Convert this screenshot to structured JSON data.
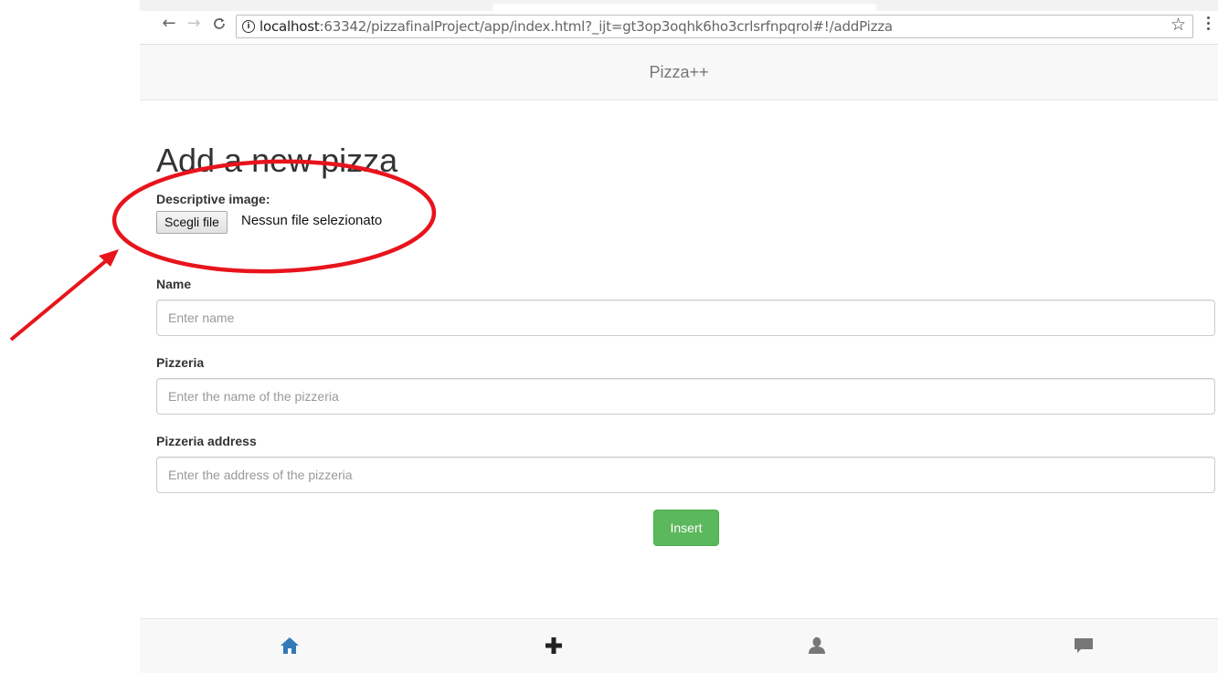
{
  "browser": {
    "url_host": "localhost",
    "url_rest": ":63342/pizzafinalProject/app/index.html?_ijt=gt3op3oqhk6ho3crlsrfnpqrol#!/addPizza",
    "back_icon": "arrow-left-icon",
    "forward_icon": "arrow-right-icon",
    "reload_icon": "reload-icon",
    "info_icon": "info-icon",
    "bookmark_icon": "star-icon",
    "menu_icon": "kebab-menu-icon"
  },
  "navbar": {
    "brand": "Pizza++"
  },
  "form": {
    "title": "Add a new pizza",
    "image_label": "Descriptive image:",
    "file_button": "Scegli file",
    "file_status": "Nessun file selezionato",
    "name_label": "Name",
    "name_placeholder": "Enter name",
    "pizzeria_label": "Pizzeria",
    "pizzeria_placeholder": "Enter the name of the pizzeria",
    "address_label": "Pizzeria address",
    "address_placeholder": "Enter the address of the pizzeria",
    "submit": "Insert"
  },
  "tabbar": {
    "items": [
      {
        "icon": "home-icon",
        "color": "#337ab7"
      },
      {
        "icon": "plus-icon",
        "color": "#222222"
      },
      {
        "icon": "user-icon",
        "color": "#777777"
      },
      {
        "icon": "comment-icon",
        "color": "#777777"
      }
    ]
  },
  "annotation": {
    "color": "#e8141c"
  },
  "colors": {
    "success": "#5cb85c",
    "link": "#337ab7"
  }
}
